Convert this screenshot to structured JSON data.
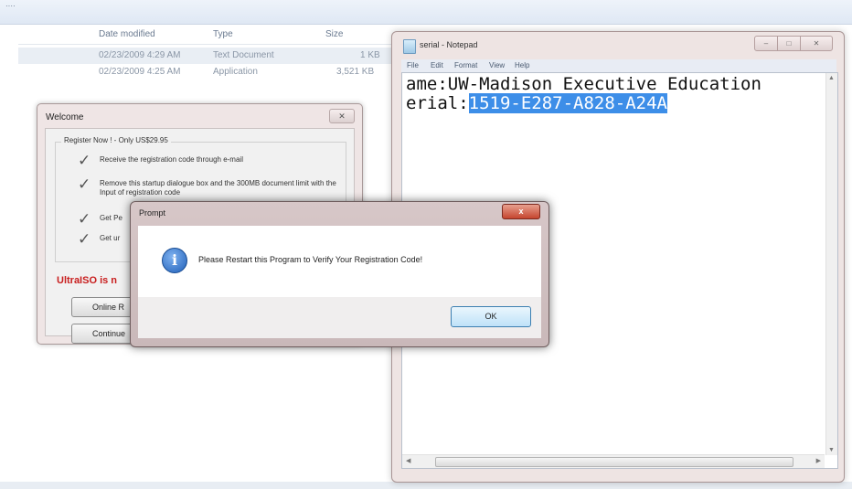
{
  "explorer": {
    "breadcrumb": "····",
    "columns": [
      "Date modified",
      "Type",
      "Size"
    ],
    "rows": [
      {
        "date": "02/23/2009 4:29 AM",
        "type": "Text Document",
        "size": "1 KB"
      },
      {
        "date": "02/23/2009 4:25 AM",
        "type": "Application",
        "size": "3,521 KB"
      }
    ]
  },
  "welcome": {
    "title": "Welcome",
    "close": "✕",
    "group_title": "Register Now ! - Only US$29.95",
    "items": [
      "Receive the registration code through e-mail",
      "Remove this startup dialogue box and the 300MB document limit with the Input of registration code",
      "Get Pe",
      "Get ur"
    ],
    "warning": "UltraISO is n",
    "buttons": [
      "Online R",
      "Continue"
    ]
  },
  "notepad": {
    "title": "serial - Notepad",
    "controls": [
      "–",
      "□",
      "✕"
    ],
    "menu": [
      "File",
      "Edit",
      "Format",
      "View",
      "Help"
    ],
    "line1": "ame:UW-Madison Executive Education",
    "line2_prefix": "erial:",
    "line2_selected": "1519-E287-A828-A24A"
  },
  "prompt": {
    "title": "Prompt",
    "close": "x",
    "icon": "information-icon",
    "message": "Please Restart this Program to Verify Your Registration Code!",
    "ok_label": "OK"
  },
  "colors": {
    "selection": "#3d8ee8",
    "warning": "#c81e1e",
    "close_red": "#c5452e"
  }
}
